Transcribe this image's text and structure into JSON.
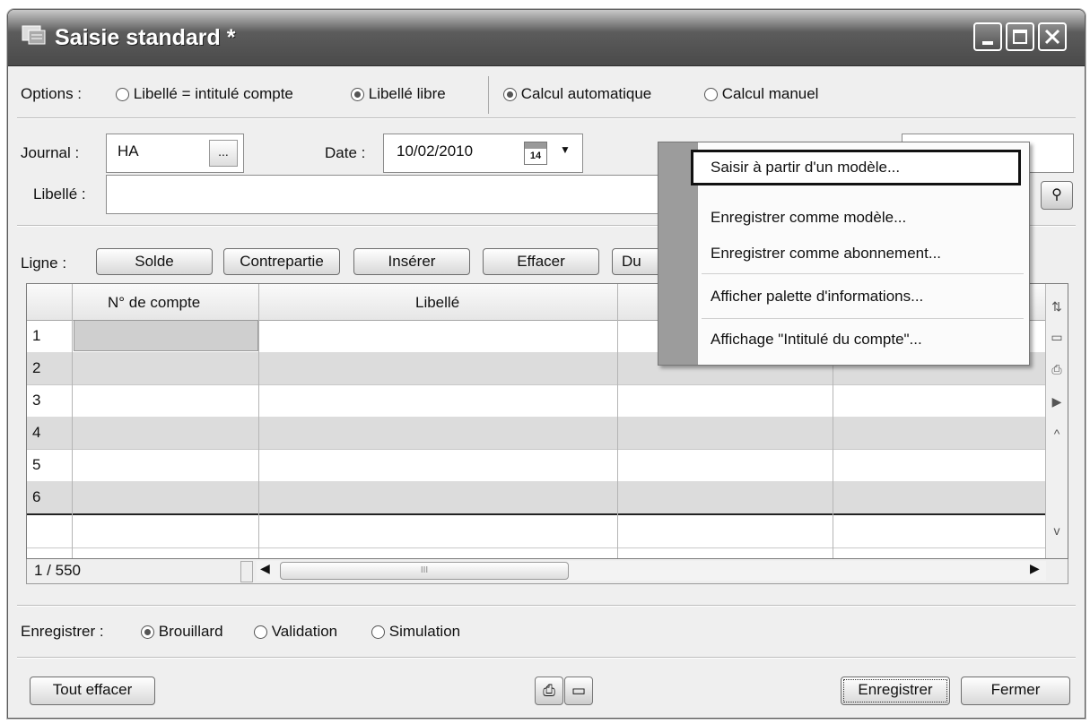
{
  "window": {
    "title": "Saisie standard *"
  },
  "options": {
    "label": "Options :",
    "radio1": "Libellé = intitulé compte",
    "radio2": "Libellé libre",
    "radio3": "Calcul automatique",
    "radio4": "Calcul manuel"
  },
  "journal": {
    "label": "Journal :",
    "value": "HA",
    "browse": "..."
  },
  "date": {
    "label": "Date :",
    "value": "10/02/2010",
    "calendar_day": "14"
  },
  "libelle": {
    "label": "Libellé :",
    "value": ""
  },
  "ligne": {
    "label": "Ligne :",
    "buttons": [
      "Solde",
      "Contrepartie",
      "Insérer",
      "Effacer",
      "Du"
    ]
  },
  "grid": {
    "headers": [
      "N° de compte",
      "Libellé"
    ],
    "rows": [
      "1",
      "2",
      "3",
      "4",
      "5",
      "6"
    ],
    "counter": "1 / 550",
    "scroll_grip": "III"
  },
  "context_menu": {
    "items": [
      "Saisir à partir d'un modèle...",
      "Enregistrer comme modèle...",
      "Enregistrer comme abonnement...",
      "Afficher palette d'informations...",
      "Affichage \"Intitulé du compte\"..."
    ]
  },
  "enregistrer": {
    "label": "Enregistrer :",
    "radio1": "Brouillard",
    "radio2": "Validation",
    "radio3": "Simulation"
  },
  "footer": {
    "clear": "Tout effacer",
    "save": "Enregistrer",
    "close": "Fermer"
  },
  "icons": [
    "window-app-icon",
    "minimize-icon",
    "maximize-icon",
    "close-icon",
    "calendar-icon",
    "print-icon",
    "screen-icon"
  ]
}
